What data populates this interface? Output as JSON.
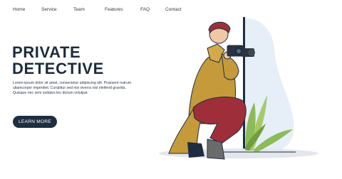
{
  "nav": {
    "items": [
      "Home",
      "Service",
      "Team",
      "Features",
      "FAQ",
      "Contact"
    ]
  },
  "hero": {
    "title_line1": "PRIVATE",
    "title_line2": "DETECTIVE",
    "body": "Lorem ipsum dolor sit amet, consectetur adipiscing elit. Praesent nutrum ullamcorper imperdiet. Curabitur sed nisi viverra nisl eleifend gravida. Quisque nec sem sodales leo dictum volutpat.",
    "cta_label": "LEARN MORE"
  },
  "colors": {
    "navy": "#1e2e40",
    "coat": "#c49a3b",
    "trousers": "#9e2f3a",
    "plant": "#8dbb57",
    "backdrop": "#e6eef8"
  }
}
